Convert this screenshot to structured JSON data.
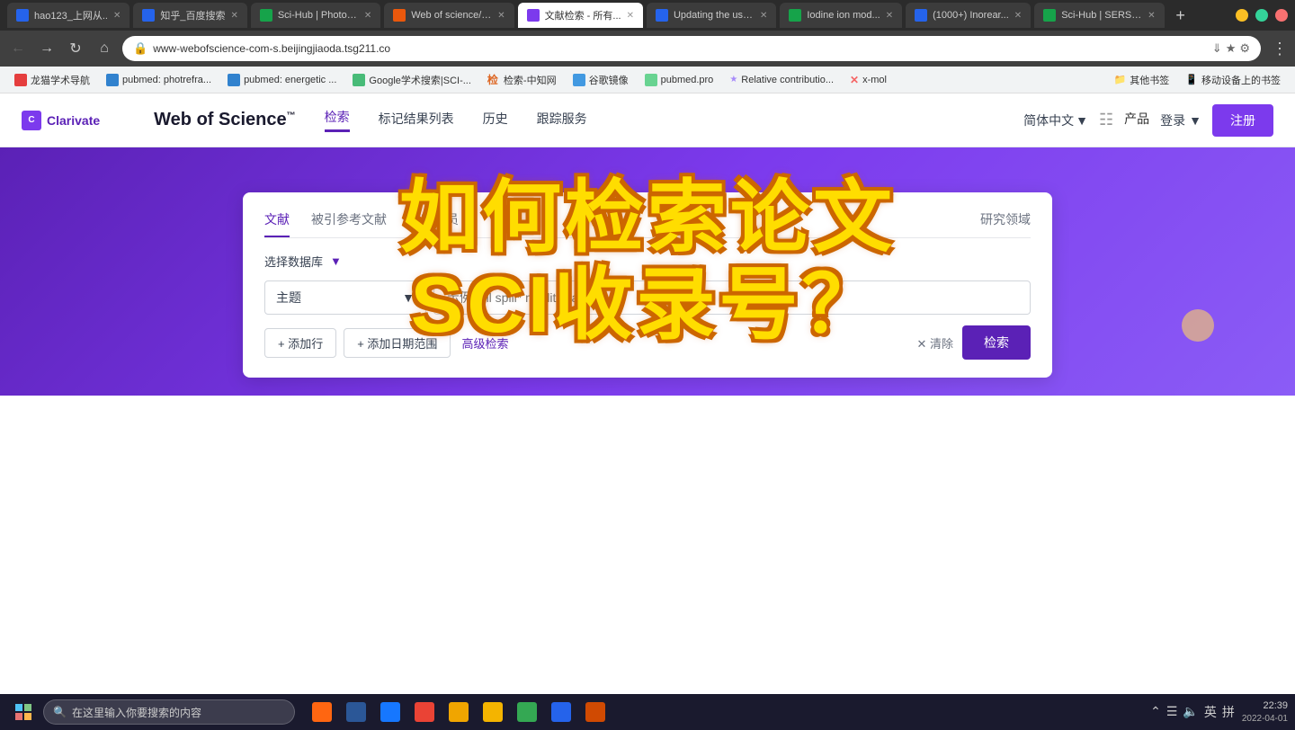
{
  "browser": {
    "tabs": [
      {
        "id": 1,
        "label": "hao123_上网从...",
        "active": false,
        "color": "blue"
      },
      {
        "id": 2,
        "label": "知乎_百度搜索",
        "active": false,
        "color": "blue"
      },
      {
        "id": 3,
        "label": "Sci-Hub | Photosen...",
        "active": false,
        "color": "green"
      },
      {
        "id": 4,
        "label": "Web of science/SCI...",
        "active": false,
        "color": "orange"
      },
      {
        "id": 5,
        "label": "文献检索 - 所有...",
        "active": true,
        "color": "purple"
      },
      {
        "id": 6,
        "label": "Updating the use c...",
        "active": false,
        "color": "blue"
      },
      {
        "id": 7,
        "label": "Iodine ion mod...",
        "active": false,
        "color": "green"
      },
      {
        "id": 8,
        "label": "(1000+) Inorear...",
        "active": false,
        "color": "blue"
      },
      {
        "id": 9,
        "label": "Sci-Hub | SERS-acti...",
        "active": false,
        "color": "green"
      }
    ],
    "url": "www-webofscience-com-s.beijingjiaoda.tsg211.co",
    "nav": {
      "back": "←",
      "forward": "→",
      "refresh": "↻",
      "home": "⌂"
    }
  },
  "bookmarks": [
    {
      "label": "龙猫学术导航",
      "type": "dragon"
    },
    {
      "label": "pubmed: photrefra...",
      "type": "pubmed"
    },
    {
      "label": "pubmed: energetic ...",
      "type": "pubmed"
    },
    {
      "label": "Google学术搜索|SCI-...",
      "type": "google"
    },
    {
      "label": "检索-中知网",
      "type": "search"
    },
    {
      "label": "谷歌镜像",
      "type": "google2"
    },
    {
      "label": "pubmed.pro",
      "type": "pubmed2"
    },
    {
      "label": "Relative contributio...",
      "type": "relative"
    },
    {
      "label": "x-mol",
      "type": "xmol"
    },
    {
      "label": "其他书签",
      "type": "folder"
    },
    {
      "label": "移动设备上的书签",
      "type": "folder"
    }
  ],
  "wos": {
    "clarivate_label": "Clarivate",
    "brand": "Web of Science",
    "brand_tm": "™",
    "nav_items": [
      "检索",
      "标记结果列表",
      "历史",
      "跟踪服务"
    ],
    "nav_active": "检索",
    "lang": "简体中文",
    "login": "登录",
    "register": "注册",
    "hero": {
      "overlay_line1": "如何检索论文",
      "overlay_line2": "SCI收录号？"
    },
    "search_card": {
      "tabs": [
        "文献",
        "被引参考文献",
        "研究人员"
      ],
      "active_tab": "文献",
      "db_label": "选择数据库",
      "field_label": "主题",
      "placeholder": "示例: oil spill* mediterranean",
      "add_row": "+ 添加行",
      "add_date": "+ 添加日期范围",
      "advanced": "高级检索",
      "clear": "✕ 清除",
      "search": "检索"
    }
  },
  "overlay": {
    "visible": true
  },
  "taskbar": {
    "search_placeholder": "在这里输入你要搜索的内容",
    "time": "22:39",
    "date": "2022-04-01",
    "lang": "英",
    "apps": [
      {
        "name": "firefox",
        "color": "firefox"
      },
      {
        "name": "word",
        "color": "word"
      },
      {
        "name": "feishu",
        "color": "feishu"
      },
      {
        "name": "browser",
        "color": "browser"
      },
      {
        "name": "files",
        "color": "files"
      },
      {
        "name": "explorer",
        "color": "explorer"
      },
      {
        "name": "green-app",
        "color": "green-app"
      },
      {
        "name": "mochi",
        "color": "mochi"
      },
      {
        "name": "ppt",
        "color": "ppt"
      }
    ]
  }
}
